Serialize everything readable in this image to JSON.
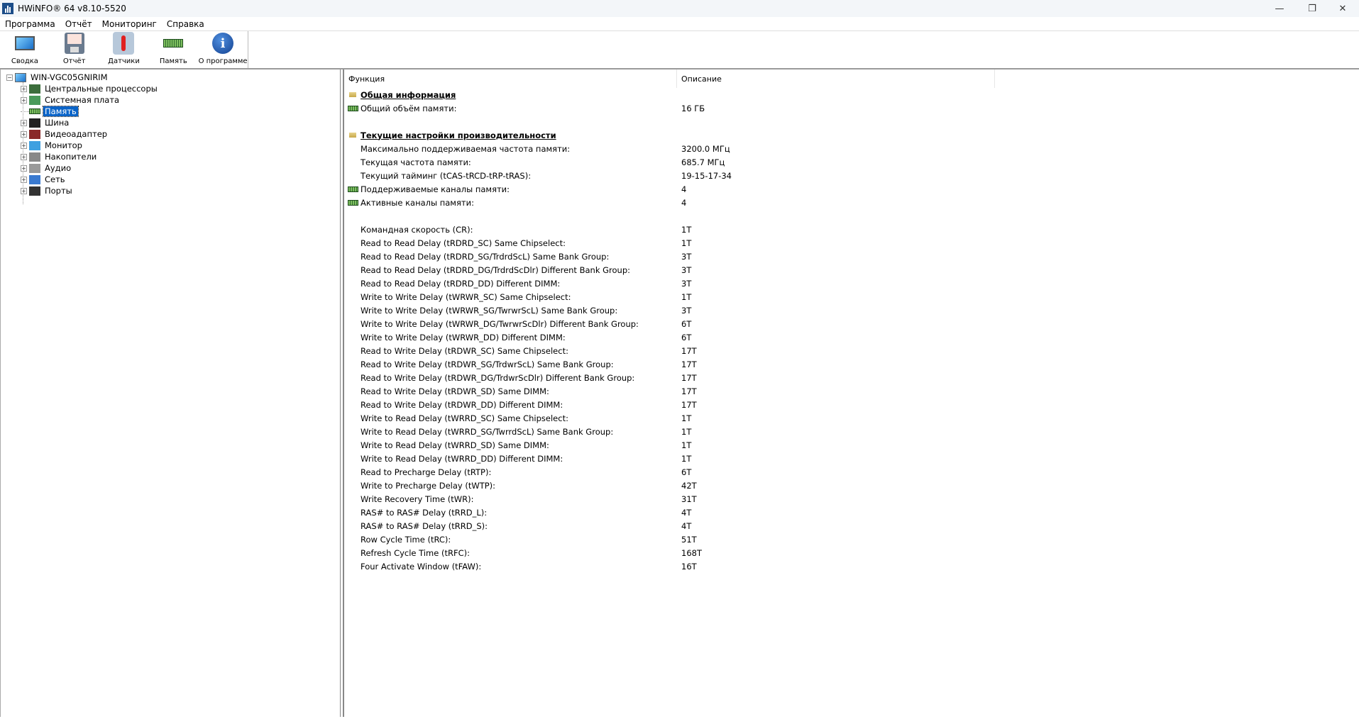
{
  "window": {
    "title": "HWiNFO® 64 v8.10-5520",
    "minimize": "—",
    "maximize": "❐",
    "close": "✕"
  },
  "menu": [
    "Программа",
    "Отчёт",
    "Мониторинг",
    "Справка"
  ],
  "toolbar": [
    {
      "label": "Сводка",
      "icon": "computer-icon"
    },
    {
      "label": "Отчёт",
      "icon": "floppy-icon"
    },
    {
      "label": "Датчики",
      "icon": "thermometer-icon"
    },
    {
      "label": "Память",
      "icon": "ram-icon"
    },
    {
      "label": "О программе",
      "icon": "info-icon"
    }
  ],
  "tree": {
    "root": "WIN-VGC05GNIRIM",
    "items": [
      {
        "label": "Центральные процессоры",
        "icon": "cpu-icon",
        "expandable": true
      },
      {
        "label": "Системная плата",
        "icon": "motherboard-icon",
        "expandable": true
      },
      {
        "label": "Память",
        "icon": "ram-icon",
        "expandable": false,
        "selected": true
      },
      {
        "label": "Шина",
        "icon": "bus-icon",
        "expandable": true
      },
      {
        "label": "Видеоадаптер",
        "icon": "gpu-icon",
        "expandable": true
      },
      {
        "label": "Монитор",
        "icon": "monitor-icon",
        "expandable": true
      },
      {
        "label": "Накопители",
        "icon": "drive-icon",
        "expandable": true
      },
      {
        "label": "Аудио",
        "icon": "speaker-icon",
        "expandable": true
      },
      {
        "label": "Сеть",
        "icon": "network-icon",
        "expandable": true
      },
      {
        "label": "Порты",
        "icon": "port-icon",
        "expandable": true
      }
    ]
  },
  "columns": {
    "function": "Функция",
    "description": "Описание"
  },
  "rows": [
    {
      "type": "section",
      "f": "Общая информация"
    },
    {
      "type": "ram",
      "f": "Общий объём памяти:",
      "v": "16 ГБ"
    },
    {
      "type": "blank"
    },
    {
      "type": "section",
      "f": "Текущие настройки производительности"
    },
    {
      "f": "Максимально поддерживаемая частота памяти:",
      "v": "3200.0 МГц"
    },
    {
      "f": "Текущая частота памяти:",
      "v": "685.7 МГц"
    },
    {
      "f": "Текущий тайминг (tCAS-tRCD-tRP-tRAS):",
      "v": "19-15-17-34"
    },
    {
      "type": "ram",
      "f": "Поддерживаемые каналы памяти:",
      "v": "4"
    },
    {
      "type": "ram",
      "f": "Активные каналы памяти:",
      "v": "4"
    },
    {
      "type": "blank"
    },
    {
      "f": "Командная скорость (CR):",
      "v": "1T"
    },
    {
      "f": "Read to Read Delay (tRDRD_SC) Same Chipselect:",
      "v": "1T"
    },
    {
      "f": "Read to Read Delay (tRDRD_SG/TrdrdScL) Same Bank Group:",
      "v": "3T"
    },
    {
      "f": "Read to Read Delay (tRDRD_DG/TrdrdScDlr) Different Bank Group:",
      "v": "3T"
    },
    {
      "f": "Read to Read Delay (tRDRD_DD) Different DIMM:",
      "v": "3T"
    },
    {
      "f": "Write to Write Delay (tWRWR_SC) Same Chipselect:",
      "v": "1T"
    },
    {
      "f": "Write to Write Delay (tWRWR_SG/TwrwrScL) Same Bank Group:",
      "v": "3T"
    },
    {
      "f": "Write to Write Delay (tWRWR_DG/TwrwrScDlr) Different Bank Group:",
      "v": "6T"
    },
    {
      "f": "Write to Write Delay (tWRWR_DD) Different DIMM:",
      "v": "6T"
    },
    {
      "f": "Read to Write Delay (tRDWR_SC) Same Chipselect:",
      "v": "17T"
    },
    {
      "f": "Read to Write Delay (tRDWR_SG/TrdwrScL) Same Bank Group:",
      "v": "17T"
    },
    {
      "f": "Read to Write Delay (tRDWR_DG/TrdwrScDlr) Different Bank Group:",
      "v": "17T"
    },
    {
      "f": "Read to Write Delay (tRDWR_SD) Same DIMM:",
      "v": "17T"
    },
    {
      "f": "Read to Write Delay (tRDWR_DD) Different DIMM:",
      "v": "17T"
    },
    {
      "f": "Write to Read Delay (tWRRD_SC) Same Chipselect:",
      "v": "1T"
    },
    {
      "f": "Write to Read Delay (tWRRD_SG/TwrrdScL) Same Bank Group:",
      "v": "1T"
    },
    {
      "f": "Write to Read Delay (tWRRD_SD) Same DIMM:",
      "v": "1T"
    },
    {
      "f": "Write to Read Delay (tWRRD_DD) Different DIMM:",
      "v": "1T"
    },
    {
      "f": "Read to Precharge Delay (tRTP):",
      "v": "6T"
    },
    {
      "f": "Write to Precharge Delay (tWTP):",
      "v": "42T"
    },
    {
      "f": "Write Recovery Time (tWR):",
      "v": "31T"
    },
    {
      "f": "RAS# to RAS# Delay (tRRD_L):",
      "v": "4T"
    },
    {
      "f": "RAS# to RAS# Delay (tRRD_S):",
      "v": "4T"
    },
    {
      "f": "Row Cycle Time (tRC):",
      "v": "51T"
    },
    {
      "f": "Refresh Cycle Time (tRFC):",
      "v": "168T"
    },
    {
      "f": "Four Activate Window (tFAW):",
      "v": "16T"
    }
  ]
}
